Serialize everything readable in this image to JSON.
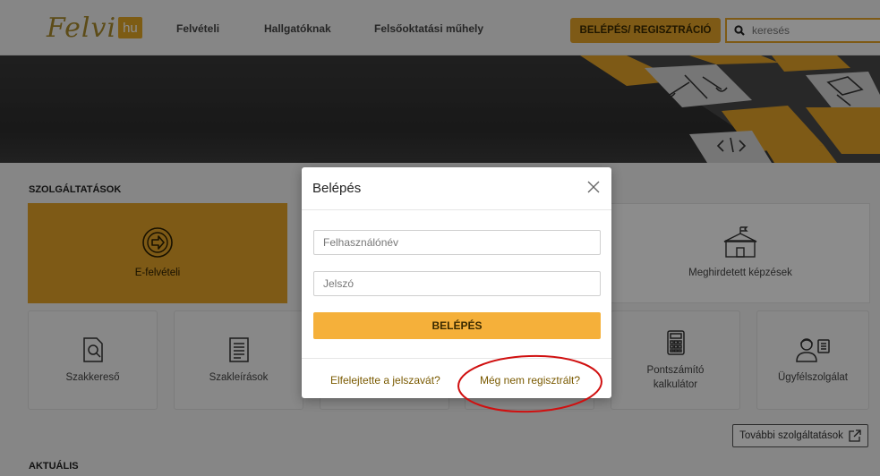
{
  "header": {
    "logo_text": "Felvi",
    "logo_badge": "hu",
    "nav": [
      "Felvételi",
      "Hallgatóknak",
      "Felsőoktatási műhely"
    ],
    "login_button": "BELÉPÉS/ REGISZTRÁCIÓ",
    "search_placeholder": "keresés"
  },
  "services": {
    "title": "SZOLGÁLTATÁSOK",
    "big_tiles": [
      {
        "label": "E-felvételi",
        "icon": "arrow-circle-icon"
      },
      {
        "label": "Meghirdetett képzések",
        "icon": "school-building-icon"
      }
    ],
    "small_tiles": [
      {
        "label": "Szakkereső",
        "icon": "document-search-icon"
      },
      {
        "label": "Szakleírások",
        "icon": "document-list-icon"
      },
      {
        "label": "Pontszámító kalkulátor",
        "icon": "calculator-icon"
      },
      {
        "label": "Ügyfélszolgálat",
        "icon": "customer-service-icon"
      }
    ],
    "more_button": "További szolgáltatások"
  },
  "news": {
    "title": "AKTUÁLIS"
  },
  "modal": {
    "title": "Belépés",
    "username_placeholder": "Felhasználónév",
    "password_placeholder": "Jelszó",
    "submit": "BELÉPÉS",
    "forgot_password": "Elfelejtette a jelszavát?",
    "register": "Még nem regisztrált?"
  },
  "colors": {
    "accent": "#e6a428",
    "button": "#f5b03a",
    "highlight": "#d01010"
  }
}
